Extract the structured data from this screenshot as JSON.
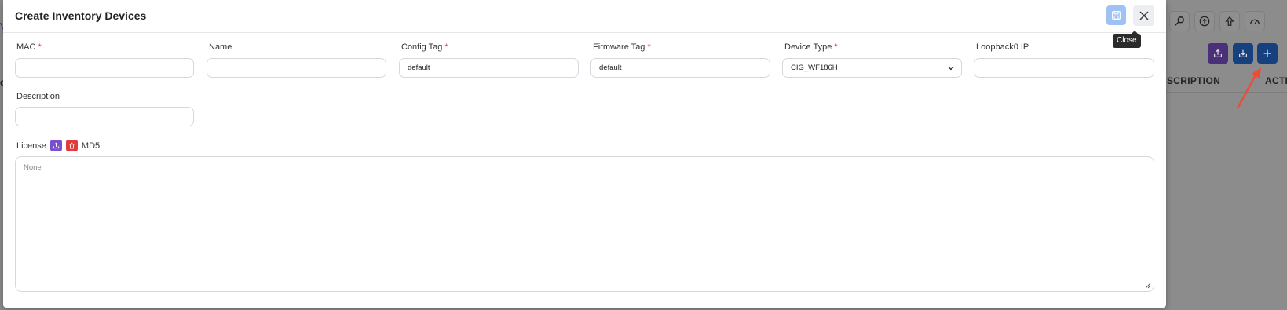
{
  "modal": {
    "title": "Create Inventory Devices",
    "tooltip": "Close",
    "fields": {
      "mac": {
        "label": "MAC",
        "required": "*",
        "value": ""
      },
      "name": {
        "label": "Name",
        "value": ""
      },
      "config_tag": {
        "label": "Config Tag",
        "required": "*",
        "value": "default"
      },
      "firmware_tag": {
        "label": "Firmware Tag",
        "required": "*",
        "value": "default"
      },
      "device_type": {
        "label": "Device Type",
        "required": "*",
        "value": "CIG_WF186H"
      },
      "loopback0_ip": {
        "label": "Loopback0 IP",
        "value": ""
      },
      "description": {
        "label": "Description",
        "value": ""
      }
    },
    "license": {
      "label": "License",
      "md5_label": "MD5:",
      "placeholder": "None"
    }
  },
  "background": {
    "left_partial_top": "V",
    "left_partial_mid": "c",
    "column_description_partial": "SCRIPTION",
    "column_actions_partial": "ACTIO"
  },
  "colors": {
    "primary": "#1f5fc7",
    "purple": "#7b4fd1",
    "red": "#e23b3b",
    "save_disabled": "#9ec2f4",
    "annotation_arrow": "#f04a3b"
  }
}
